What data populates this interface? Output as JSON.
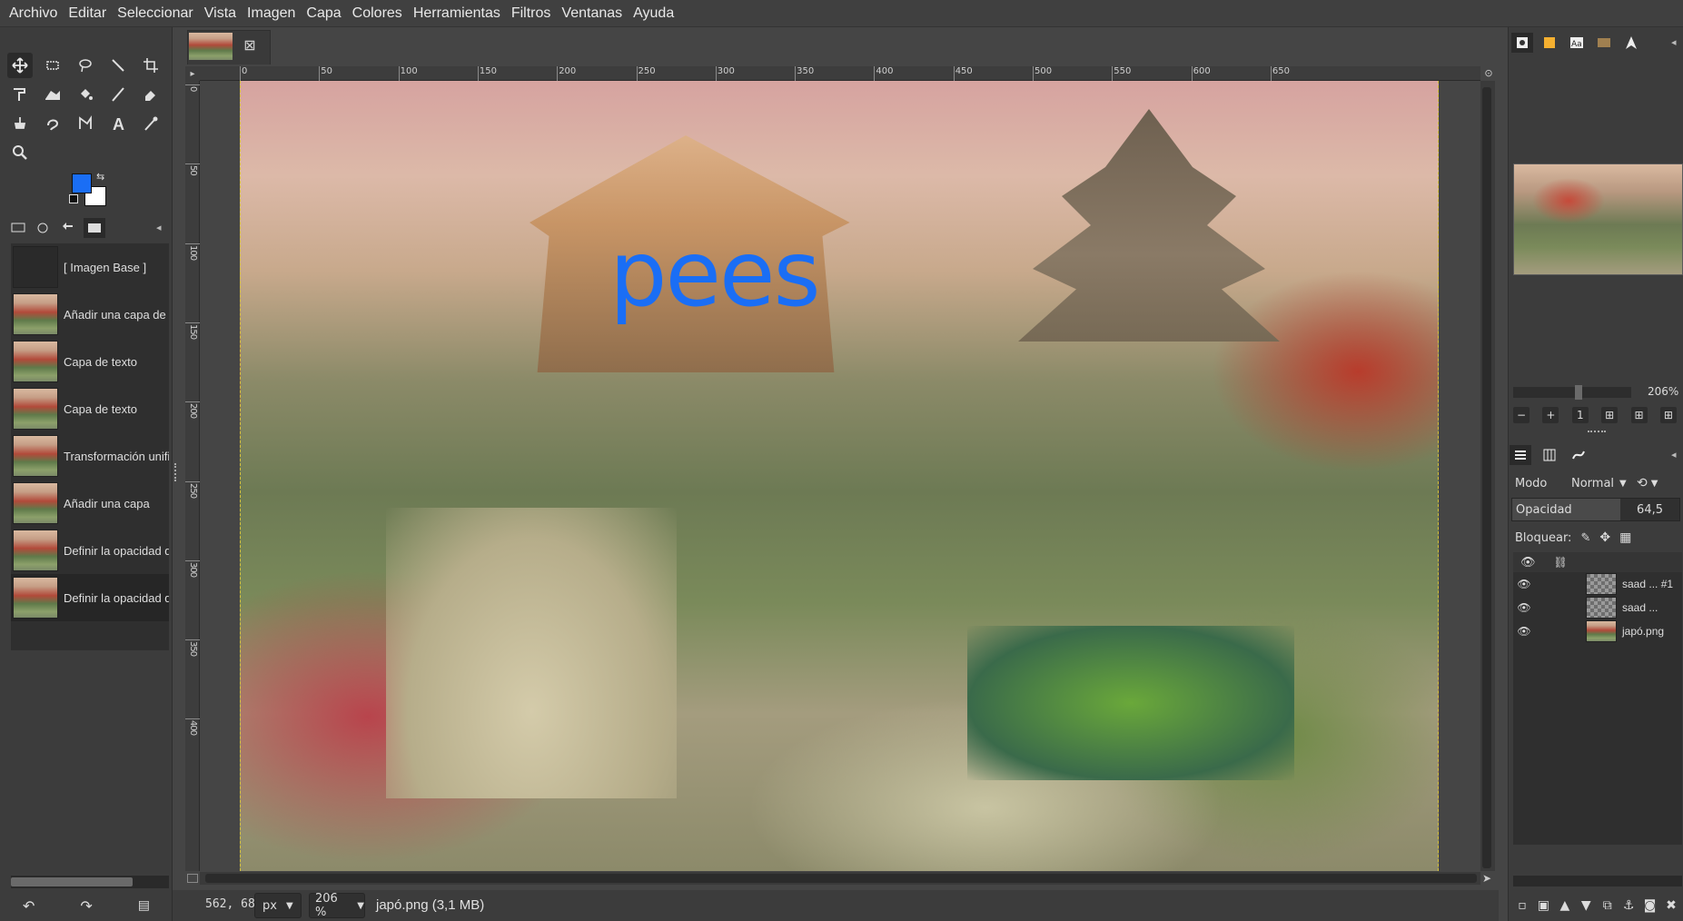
{
  "menubar": {
    "items": [
      "Archivo",
      "Editar",
      "Seleccionar",
      "Vista",
      "Imagen",
      "Capa",
      "Colores",
      "Herramientas",
      "Filtros",
      "Ventanas",
      "Ayuda"
    ]
  },
  "toolbox": {
    "tools": [
      "move-tool",
      "rect-select-tool",
      "free-select-tool",
      "fuzzy-select-tool",
      "crop-tool",
      "unified-transform-tool",
      "warp-tool",
      "bucket-fill-tool",
      "paintbrush-tool",
      "eraser-tool",
      "clone-tool",
      "smudge-tool",
      "paths-tool",
      "text-tool",
      "color-picker-tool",
      "zoom-tool"
    ],
    "fg_color": "#1a6ef5",
    "bg_color": "#ffffff"
  },
  "history": {
    "items": [
      {
        "label": "[ Imagen Base ]",
        "thumb": "blank"
      },
      {
        "label": "Añadir una capa de te",
        "thumb": "image"
      },
      {
        "label": "Capa de texto",
        "thumb": "image"
      },
      {
        "label": "Capa de texto",
        "thumb": "image"
      },
      {
        "label": "Transformación unific",
        "thumb": "image"
      },
      {
        "label": "Añadir una capa",
        "thumb": "image"
      },
      {
        "label": "Definir la opacidad de",
        "thumb": "image"
      },
      {
        "label": "Definir la opacidad de",
        "thumb": "image",
        "selected": true
      }
    ]
  },
  "ruler": {
    "h_labels": [
      "0",
      "50",
      "100",
      "150",
      "200",
      "250",
      "300",
      "350",
      "400",
      "450",
      "500",
      "550",
      "600",
      "650"
    ],
    "v_labels": [
      "0",
      "50",
      "100",
      "150",
      "200",
      "250",
      "300",
      "350",
      "400"
    ]
  },
  "canvas": {
    "text_layer": "pees",
    "text_color": "#1a6ef5"
  },
  "status": {
    "coords": "562, 68",
    "unit": "px",
    "zoom": "206 %",
    "file": "japó.png (3,1 MB)"
  },
  "navigator": {
    "zoom": "206%"
  },
  "layers_panel": {
    "mode_label": "Modo",
    "mode_value": "Normal",
    "opacity_label": "Opacidad",
    "opacity_value": "64,5",
    "opacity_fraction": 0.645,
    "lock_label": "Bloquear:",
    "layers": [
      {
        "name": "saad ... #1",
        "thumb": "checker"
      },
      {
        "name": "saad ...",
        "thumb": "checker"
      },
      {
        "name": "japó.png",
        "thumb": "image"
      }
    ]
  }
}
